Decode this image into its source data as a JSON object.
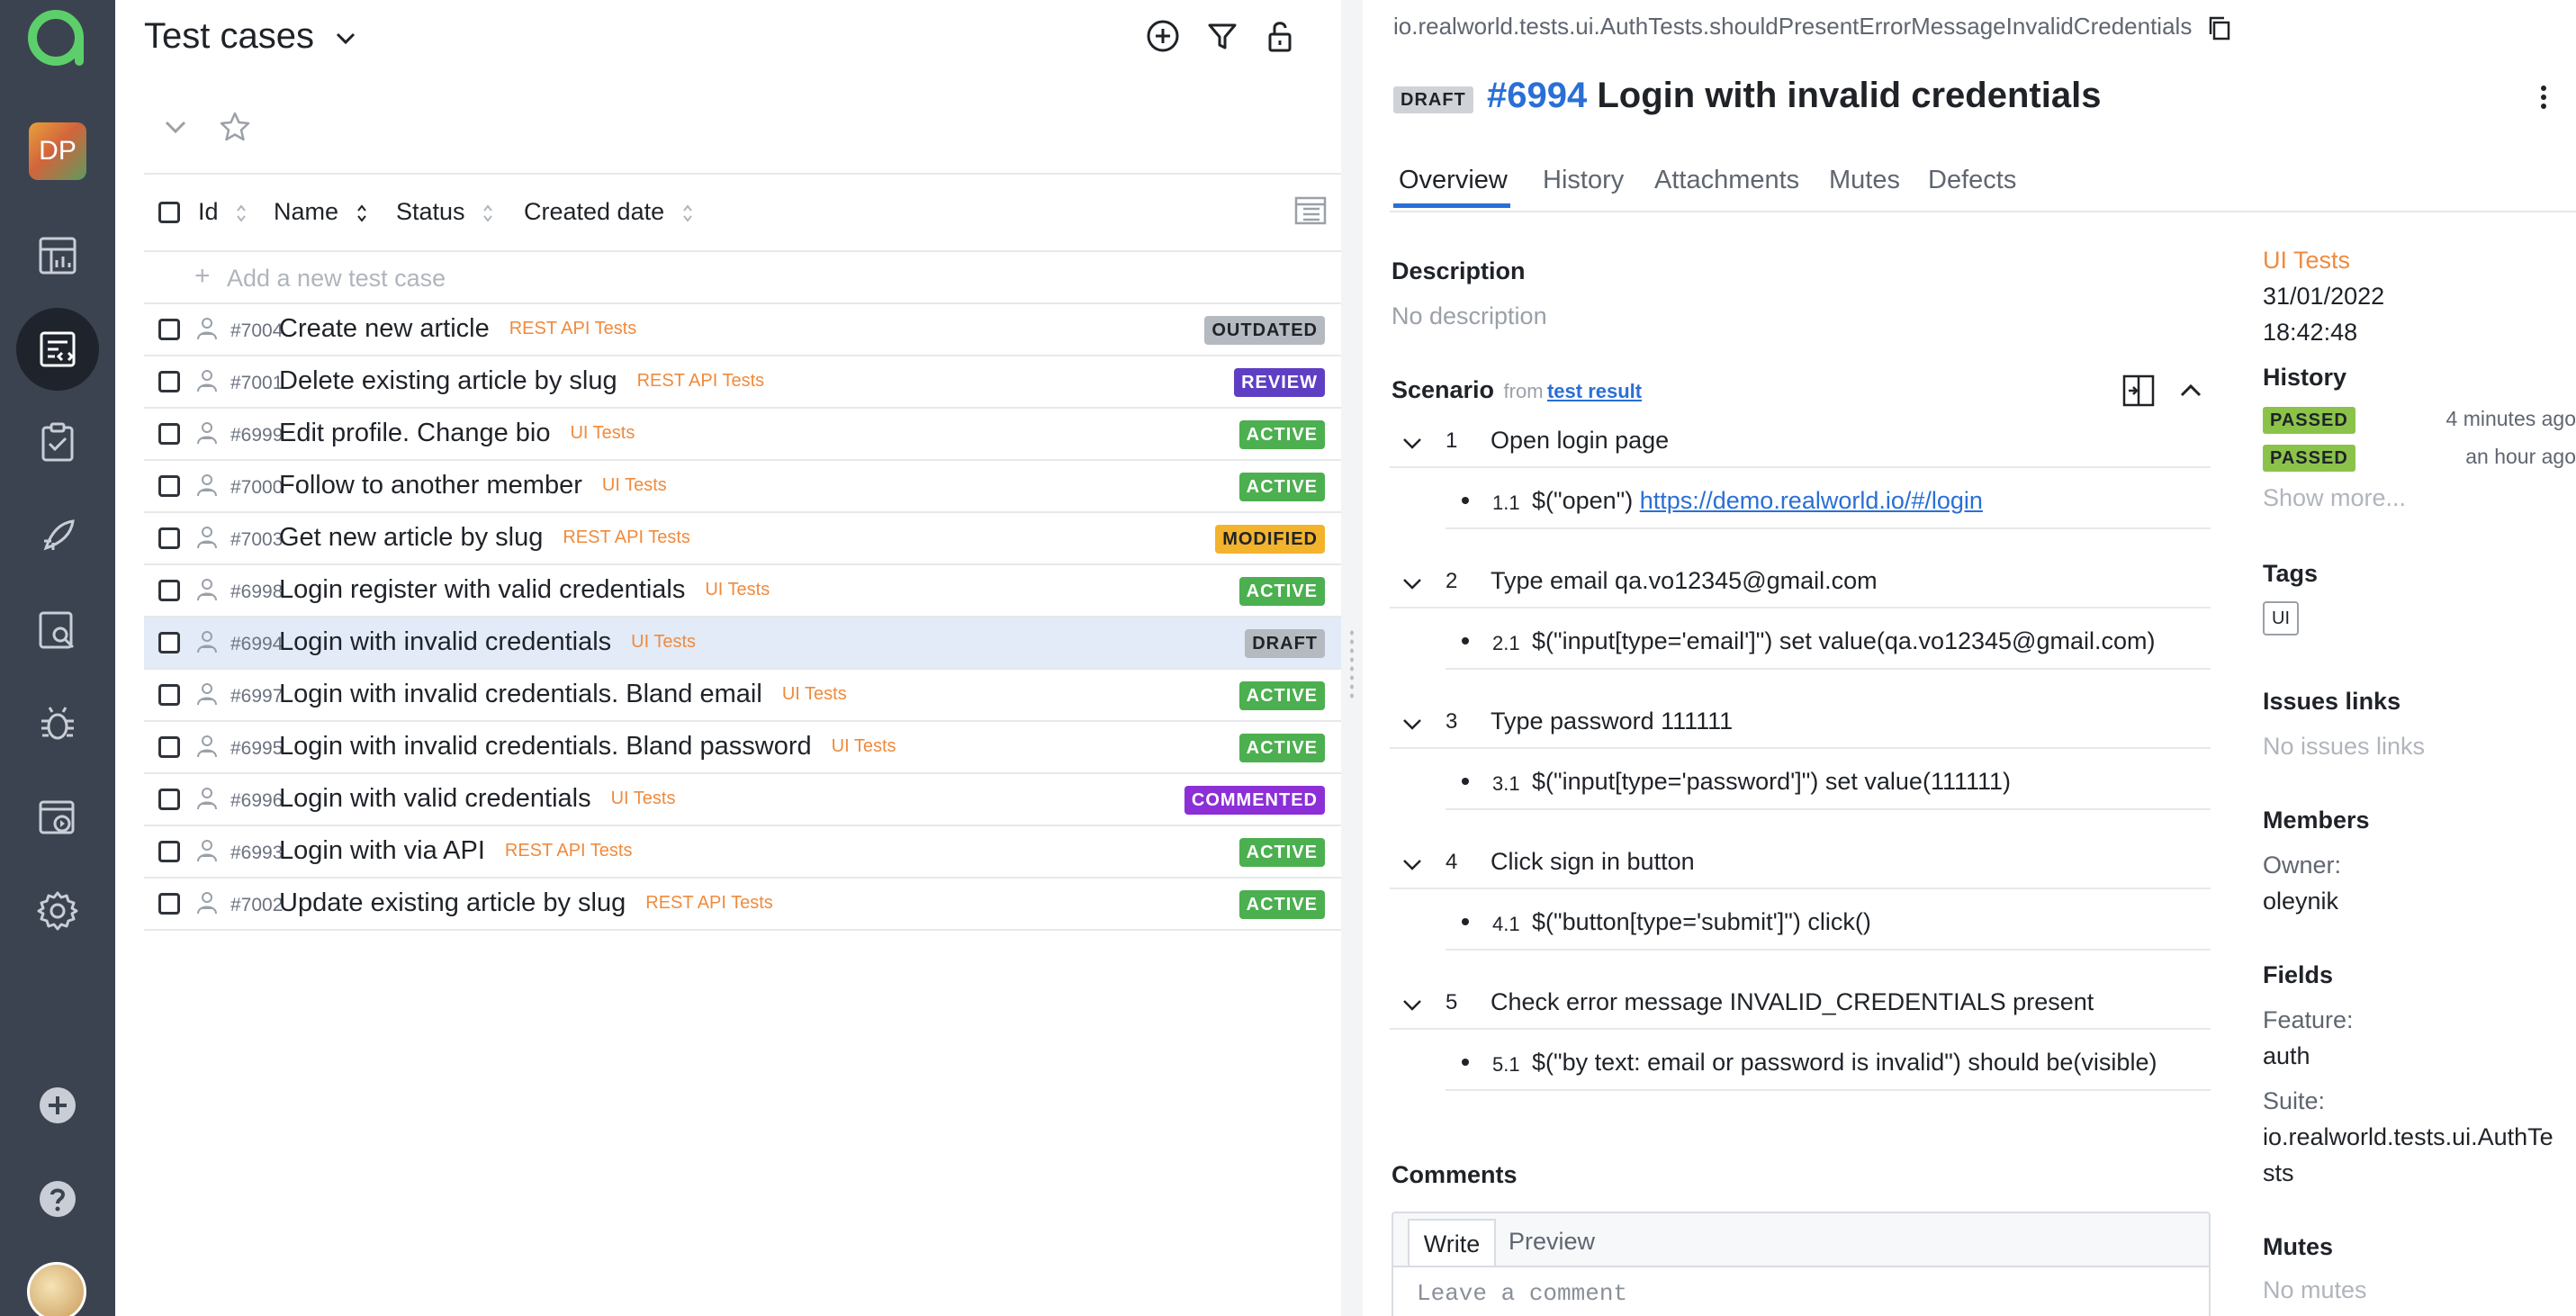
{
  "list": {
    "title": "Test cases",
    "columns": {
      "id": "Id",
      "name": "Name",
      "status": "Status",
      "created": "Created date"
    },
    "add_placeholder": "Add a new test case",
    "rows": [
      {
        "id": "#7004",
        "name": "Create new article",
        "suite": "REST API Tests",
        "status": "OUTDATED"
      },
      {
        "id": "#7001",
        "name": "Delete existing article by slug",
        "suite": "REST API Tests",
        "status": "REVIEW"
      },
      {
        "id": "#6999",
        "name": "Edit profile. Change bio",
        "suite": "UI Tests",
        "status": "ACTIVE"
      },
      {
        "id": "#7000",
        "name": "Follow to another member",
        "suite": "UI Tests",
        "status": "ACTIVE"
      },
      {
        "id": "#7003",
        "name": "Get new article by slug",
        "suite": "REST API Tests",
        "status": "MODIFIED"
      },
      {
        "id": "#6998",
        "name": "Login register with valid credentials",
        "suite": "UI Tests",
        "status": "ACTIVE"
      },
      {
        "id": "#6994",
        "name": "Login with invalid credentials",
        "suite": "UI Tests",
        "status": "DRAFT",
        "selected": true
      },
      {
        "id": "#6997",
        "name": "Login with invalid credentials. Bland email",
        "suite": "UI Tests",
        "status": "ACTIVE"
      },
      {
        "id": "#6995",
        "name": "Login with invalid credentials. Bland password",
        "suite": "UI Tests",
        "status": "ACTIVE"
      },
      {
        "id": "#6996",
        "name": "Login with valid credentials",
        "suite": "UI Tests",
        "status": "COMMENTED"
      },
      {
        "id": "#6993",
        "name": "Login with via API",
        "suite": "REST API Tests",
        "status": "ACTIVE"
      },
      {
        "id": "#7002",
        "name": "Update existing article by slug",
        "suite": "REST API Tests",
        "status": "ACTIVE"
      }
    ]
  },
  "sidebar": {
    "project_avatar": "DP"
  },
  "detail": {
    "path": "io.realworld.tests.ui.AuthTests.shouldPresentErrorMessageInvalidCredentials",
    "badge": "DRAFT",
    "id": "#6994",
    "title": "Login with invalid credentials",
    "tabs": [
      "Overview",
      "History",
      "Attachments",
      "Mutes",
      "Defects"
    ],
    "description_label": "Description",
    "description": "No description",
    "scenario_label": "Scenario",
    "scenario_from": "from",
    "scenario_link": "test result",
    "steps": [
      {
        "num": "1",
        "text": "Open login page",
        "sub_num": "1.1",
        "sub_pre": "$(\"open\") ",
        "sub_link": "https://demo.realworld.io/#/login"
      },
      {
        "num": "2",
        "text": "Type email qa.vo12345@gmail.com",
        "sub_num": "2.1",
        "sub_pre": "$(\"input[type='email']\") set value(qa.vo12345@gmail.com)",
        "sub_link": ""
      },
      {
        "num": "3",
        "text": "Type password 111111",
        "sub_num": "3.1",
        "sub_pre": "$(\"input[type='password']\") set value(111111)",
        "sub_link": ""
      },
      {
        "num": "4",
        "text": "Click sign in button",
        "sub_num": "4.1",
        "sub_pre": "$(\"button[type='submit']\") click()",
        "sub_link": ""
      },
      {
        "num": "5",
        "text": "Check error message INVALID_CREDENTIALS present",
        "sub_num": "5.1",
        "sub_pre": "$(\"by text: email or password is invalid\") should be(visible)",
        "sub_link": ""
      }
    ],
    "comments_label": "Comments",
    "comment_tabs": {
      "write": "Write",
      "preview": "Preview"
    },
    "comment_placeholder": "Leave a comment",
    "side": {
      "suite": "UI Tests",
      "date": "31/01/2022",
      "time": "18:42:48",
      "history_label": "History",
      "history": [
        {
          "status": "PASSED",
          "when": "4 minutes ago"
        },
        {
          "status": "PASSED",
          "when": "an hour ago"
        }
      ],
      "show_more": "Show more...",
      "tags_label": "Tags",
      "tag": "UI",
      "issues_label": "Issues links",
      "issues_value": "No issues links",
      "members_label": "Members",
      "owner_label": "Owner:",
      "owner": "oleynik",
      "fields_label": "Fields",
      "feature_label": "Feature:",
      "feature": "auth",
      "suite_label": "Suite:",
      "suite_line1": "io.realworld.tests.ui.AuthTe",
      "suite_line2": "sts",
      "mutes_label": "Mutes",
      "mutes_value": "No mutes"
    }
  }
}
